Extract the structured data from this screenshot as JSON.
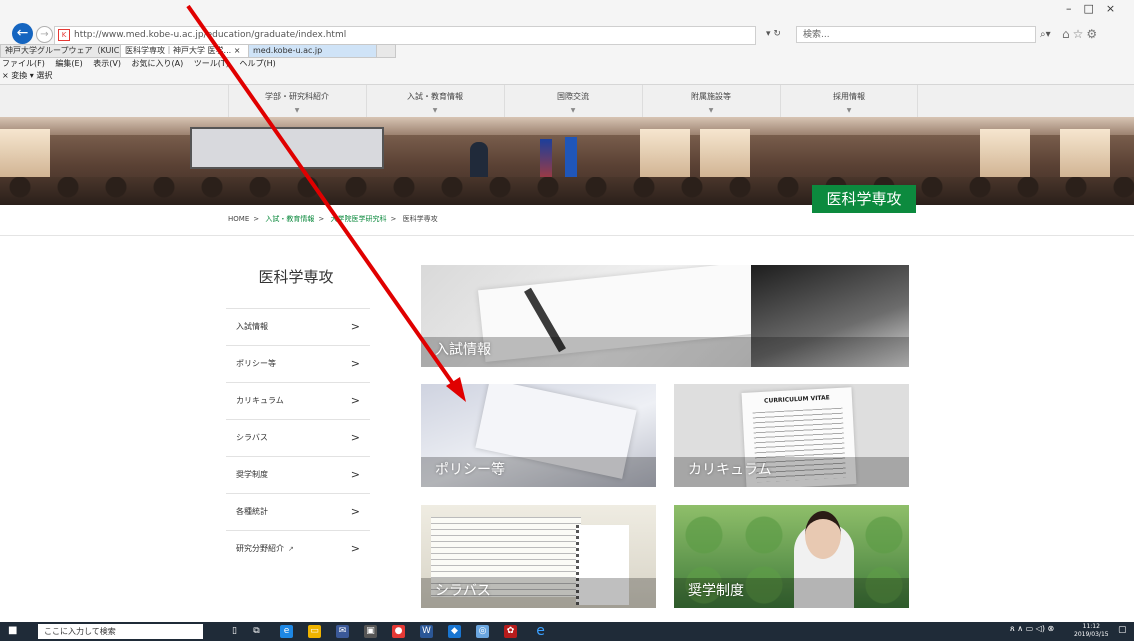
{
  "browser": {
    "url": "http://www.med.kobe-u.ac.jp/education/graduate/index.html",
    "search_placeholder": "検索...",
    "tabs": [
      {
        "label": "神戸大学グループウェア（KUIC）"
      },
      {
        "label": "医科学専攻｜神戸大学 医学..."
      },
      {
        "label": "med.kobe-u.ac.jp"
      }
    ],
    "menu": [
      "ファイル(F)",
      "編集(E)",
      "表示(V)",
      "お気に入り(A)",
      "ツール(T)",
      "ヘルプ(H)"
    ],
    "commands": [
      "× 変換",
      "▾ 選択"
    ]
  },
  "site_nav": [
    "学部・研究科紹介",
    "入試・教育情報",
    "国際交流",
    "附属施設等",
    "採用情報"
  ],
  "hero": {
    "title": "医科学専攻"
  },
  "breadcrumb": [
    "HOME",
    "入試・教育情報",
    "大学院医学研究科",
    "医科学専攻"
  ],
  "sidebar": {
    "title": "医科学専攻",
    "items": [
      {
        "label": "入試情報"
      },
      {
        "label": "ポリシー等"
      },
      {
        "label": "カリキュラム"
      },
      {
        "label": "シラバス"
      },
      {
        "label": "奨学制度"
      },
      {
        "label": "各種統計"
      },
      {
        "label": "研究分野紹介"
      }
    ]
  },
  "cards": {
    "admission": "入試情報",
    "policy": "ポリシー等",
    "curriculum": "カリキュラム",
    "curriculum_doc": "CURRICULUM VITAE",
    "syllabus": "シラバス",
    "scholarship": "奨学制度"
  },
  "taskbar": {
    "search_placeholder": "ここに入力して検索",
    "time": "11:12",
    "date": "2019/03/15"
  },
  "colors": {
    "accent": "#0c8a3e",
    "annotation_arrow": "#e00000"
  }
}
